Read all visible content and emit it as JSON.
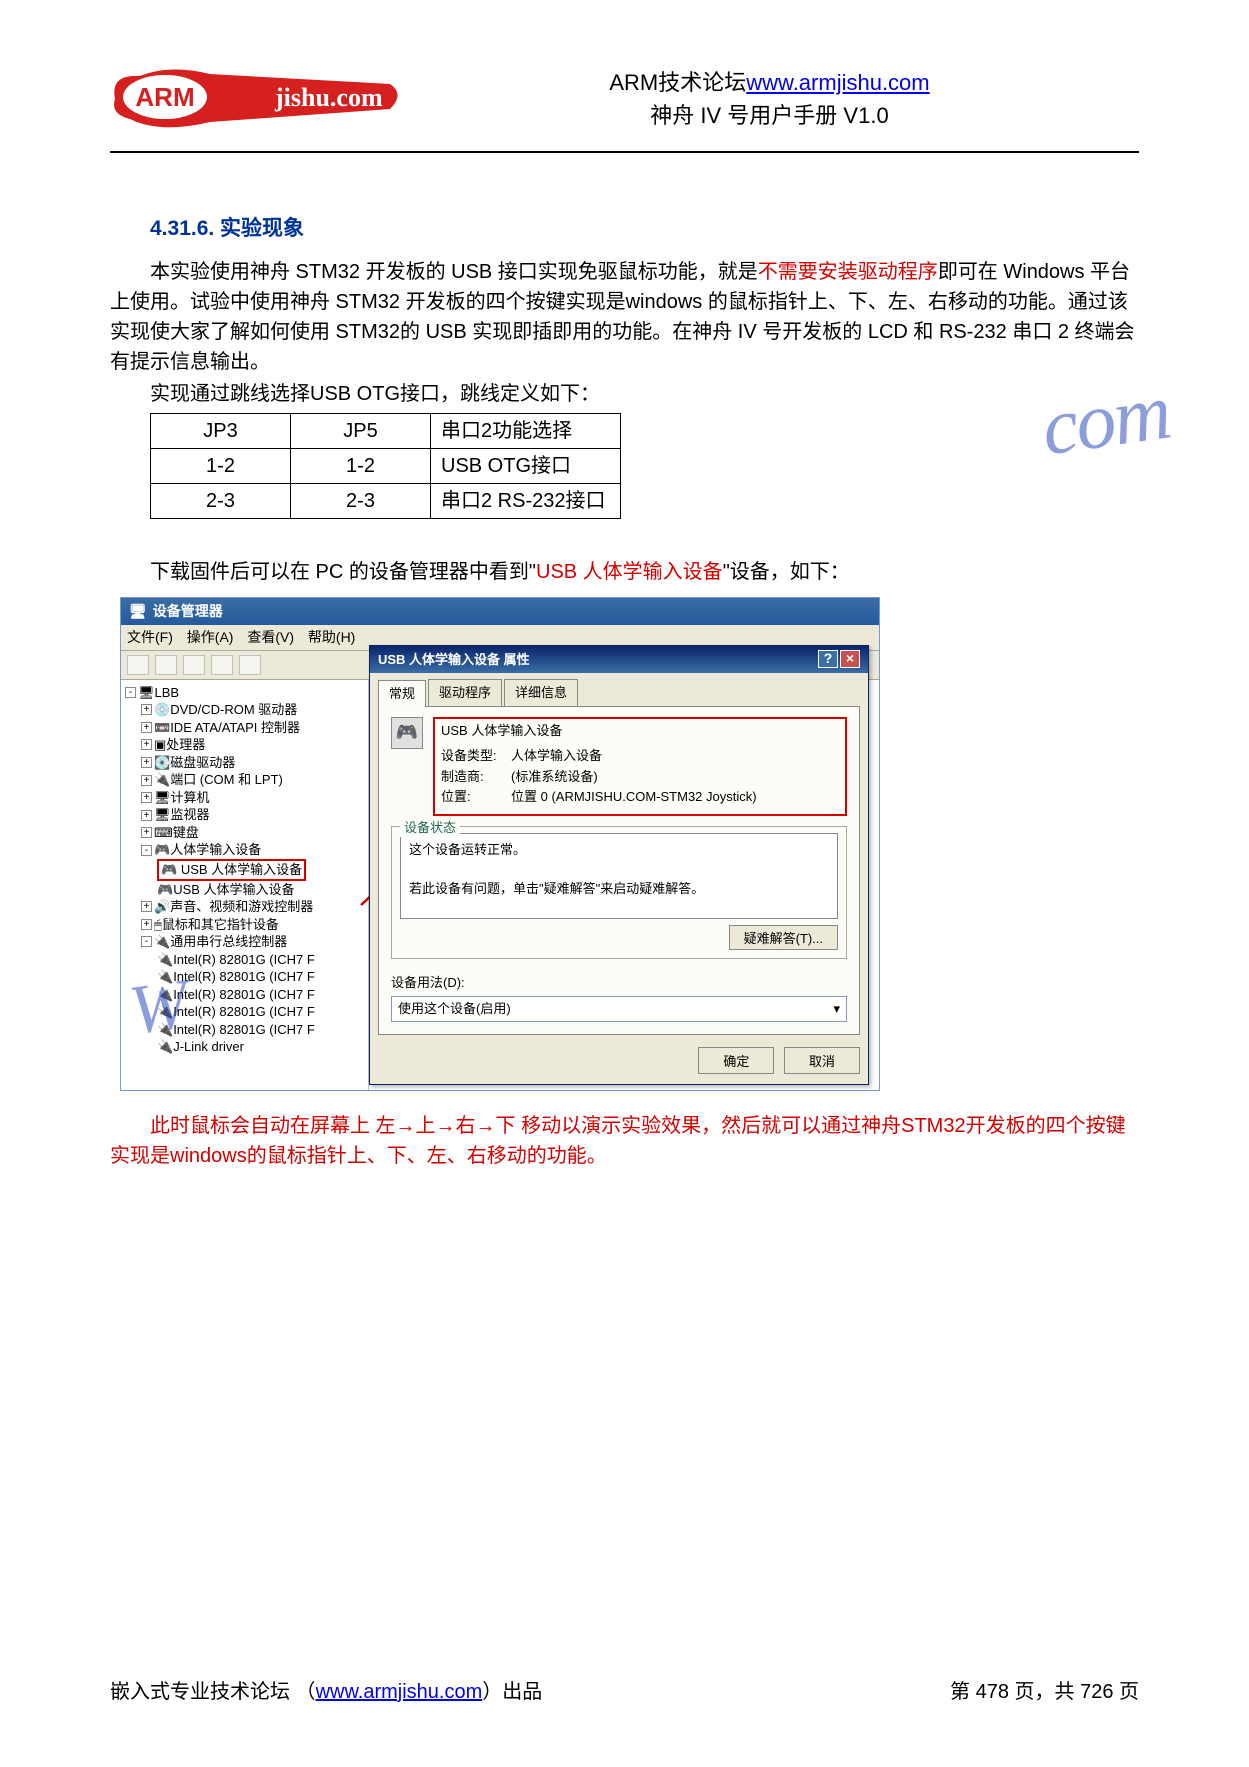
{
  "header": {
    "forum_text": "ARM技术论坛",
    "forum_url": "www.armjishu.com",
    "manual_title": "神舟 IV 号用户手册  V1.0"
  },
  "logo": {
    "arm": "ARM",
    "domain": "jishu.com"
  },
  "section": {
    "number_title": "4.31.6. 实验现象"
  },
  "para1": {
    "t1": "本实验使用神舟 STM32 开发板的 USB 接口实现免驱鼠标功能，就是",
    "red": "不需要安装驱动程序",
    "t2": "即可在 Windows 平台上使用。试验中使用神舟 STM32 开发板的四个按键实现是windows 的鼠标指针上、下、左、右移动的功能。通过该实现使大家了解如何使用 STM32的 USB 实现即插即用的功能。在神舟 IV 号开发板的 LCD 和 RS-232 串口 2 终端会有提示信息输出。"
  },
  "para2": "实现通过跳线选择USB OTG接口，跳线定义如下：",
  "table": {
    "h1": "JP3",
    "h2": "JP5",
    "h3": "串口2功能选择",
    "r1c1": "1-2",
    "r1c2": "1-2",
    "r1c3": "USB OTG接口",
    "r2c1": "2-3",
    "r2c2": "2-3",
    "r2c3": "串口2 RS-232接口"
  },
  "para3": {
    "t1": "下载固件后可以在 PC 的设备管理器中看到\"",
    "red": "USB  人体学输入设备",
    "t2": "\"设备，如下："
  },
  "devmgr": {
    "title": "设备管理器",
    "menu": {
      "file": "文件(F)",
      "action": "操作(A)",
      "view": "查看(V)",
      "help": "帮助(H)"
    },
    "tree": {
      "root": "LBB",
      "dvd": "DVD/CD-ROM 驱动器",
      "ide": "IDE ATA/ATAPI 控制器",
      "cpu": "处理器",
      "disk": "磁盘驱动器",
      "ports": "端口 (COM 和 LPT)",
      "computer": "计算机",
      "monitor": "监视器",
      "keyboard": "键盘",
      "hid": "人体学输入设备",
      "hid1": "USB 人体学输入设备",
      "hid2": "USB 人体学输入设备",
      "sound": "声音、视频和游戏控制器",
      "mouse": "鼠标和其它指针设备",
      "usb": "通用串行总线控制器",
      "intel": "Intel(R) 82801G (ICH7 F",
      "jlink": "J-Link driver"
    }
  },
  "dialog": {
    "title": "USB 人体学输入设备 属性",
    "tabs": {
      "general": "常规",
      "driver": "驱动程序",
      "details": "详细信息"
    },
    "dev_name": "USB 人体学输入设备",
    "type_k": "设备类型:",
    "type_v": "人体学输入设备",
    "mfr_k": "制造商:",
    "mfr_v": "(标准系统设备)",
    "loc_k": "位置:",
    "loc_v": "位置 0 (ARMJISHU.COM-STM32 Joystick)",
    "status_legend": "设备状态",
    "status1": "这个设备运转正常。",
    "status2": "若此设备有问题，单击\"疑难解答\"来启动疑难解答。",
    "trouble_btn": "疑难解答(T)...",
    "usage_label": "设备用法(D):",
    "usage_value": "使用这个设备(启用)",
    "ok": "确定",
    "cancel": "取消"
  },
  "red_para": "此时鼠标会自动在屏幕上 左→上→右→下 移动以演示实验效果，然后就可以通过神舟STM32开发板的四个按键实现是windows的鼠标指针上、下、左、右移动的功能。",
  "footer": {
    "left1": "嵌入式专业技术论坛 （",
    "link": "www.armjishu.com",
    "left2": "）出品",
    "right": "第 478 页，共 726 页"
  },
  "watermark": {
    "c": "com",
    "w": "W"
  }
}
